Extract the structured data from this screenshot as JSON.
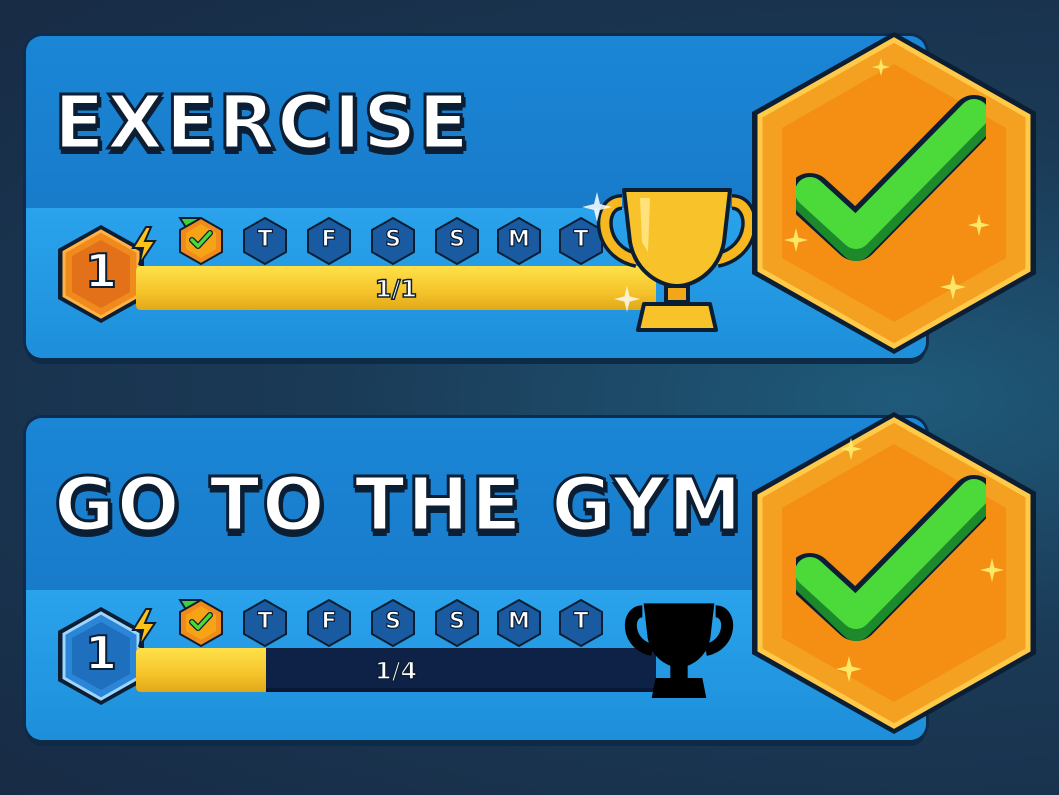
{
  "tasks": [
    {
      "title": "EXERCISE",
      "level": "1",
      "level_style": "orange",
      "progress_text": "1/1",
      "progress": 1.0,
      "days": [
        "T",
        "F",
        "S",
        "S",
        "M",
        "T"
      ],
      "trophy": "gold-trophy-icon",
      "completed": true
    },
    {
      "title": "GO TO THE GYM",
      "level": "1",
      "level_style": "blue",
      "progress_text": "1/4",
      "progress": 0.25,
      "days": [
        "T",
        "F",
        "S",
        "S",
        "M",
        "T"
      ],
      "trophy": "locked-trophy-icon",
      "completed": true
    }
  ],
  "colors": {
    "card_blue": "#1572c0",
    "track_dark": "#0e2146",
    "progress_yellow": "#f5c32a",
    "badge_orange": "#f7a316",
    "check_green": "#4cd93a"
  }
}
